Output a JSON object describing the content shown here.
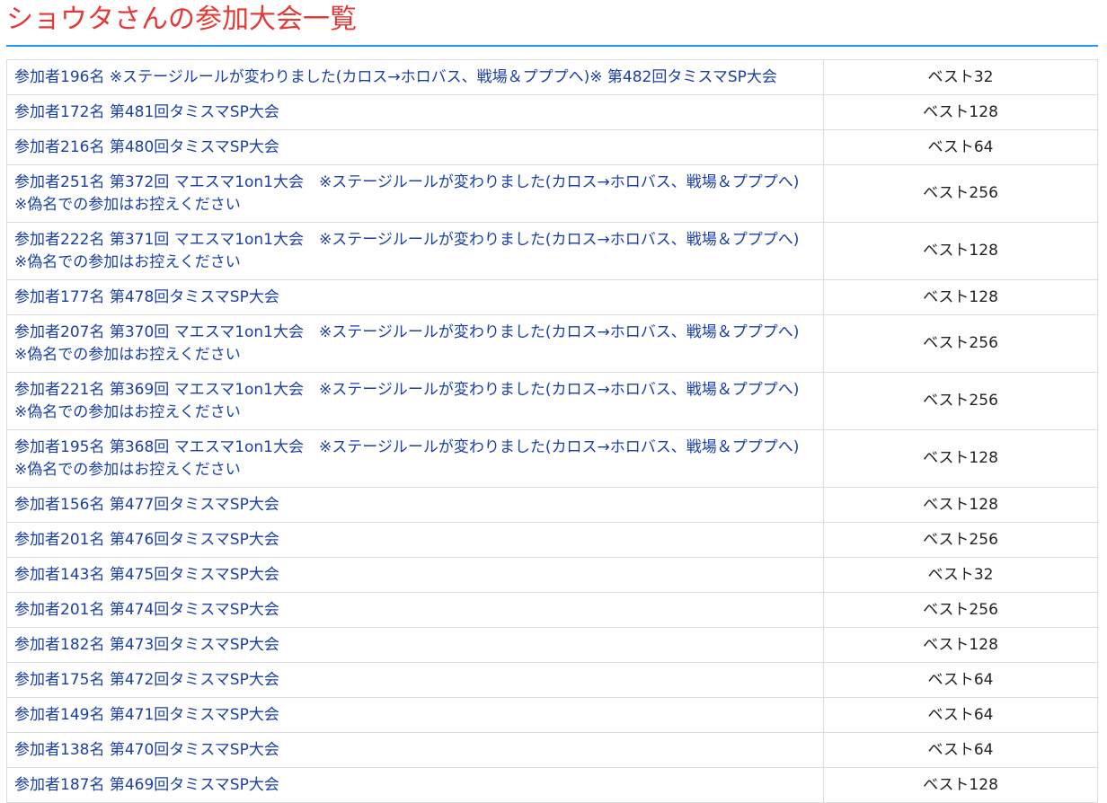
{
  "page": {
    "title": "ショウタさんの参加大会一覧"
  },
  "colors": {
    "title": "#e53935",
    "rule": "#2196f3",
    "link": "#1a40a8",
    "border": "#dddddd"
  },
  "tournaments": [
    {
      "event": "参加者196名 ※ステージルールが変わりました(カロス→ホロバス、戦場＆プププへ)※ 第482回タミスマSP大会",
      "result": "ベスト32"
    },
    {
      "event": "参加者172名 第481回タミスマSP大会",
      "result": "ベスト128"
    },
    {
      "event": "参加者216名 第480回タミスマSP大会",
      "result": "ベスト64"
    },
    {
      "event": "参加者251名 第372回 マエスマ1on1大会　※ステージルールが変わりました(カロス→ホロバス、戦場＆プププへ)　※偽名での参加はお控えください",
      "result": "ベスト256"
    },
    {
      "event": "参加者222名 第371回 マエスマ1on1大会　※ステージルールが変わりました(カロス→ホロバス、戦場＆プププへ)　※偽名での参加はお控えください",
      "result": "ベスト128"
    },
    {
      "event": "参加者177名 第478回タミスマSP大会",
      "result": "ベスト128"
    },
    {
      "event": "参加者207名 第370回 マエスマ1on1大会　※ステージルールが変わりました(カロス→ホロバス、戦場＆プププへ)　※偽名での参加はお控えください",
      "result": "ベスト256"
    },
    {
      "event": "参加者221名 第369回 マエスマ1on1大会　※ステージルールが変わりました(カロス→ホロバス、戦場＆プププへ)　※偽名での参加はお控えください",
      "result": "ベスト256"
    },
    {
      "event": "参加者195名 第368回 マエスマ1on1大会　※ステージルールが変わりました(カロス→ホロバス、戦場＆プププへ)　※偽名での参加はお控えください",
      "result": "ベスト128"
    },
    {
      "event": "参加者156名 第477回タミスマSP大会",
      "result": "ベスト128"
    },
    {
      "event": "参加者201名 第476回タミスマSP大会",
      "result": "ベスト256"
    },
    {
      "event": "参加者143名 第475回タミスマSP大会",
      "result": "ベスト32"
    },
    {
      "event": "参加者201名 第474回タミスマSP大会",
      "result": "ベスト256"
    },
    {
      "event": "参加者182名 第473回タミスマSP大会",
      "result": "ベスト128"
    },
    {
      "event": "参加者175名 第472回タミスマSP大会",
      "result": "ベスト64"
    },
    {
      "event": "参加者149名 第471回タミスマSP大会",
      "result": "ベスト64"
    },
    {
      "event": "参加者138名 第470回タミスマSP大会",
      "result": "ベスト64"
    },
    {
      "event": "参加者187名 第469回タミスマSP大会",
      "result": "ベスト128"
    }
  ]
}
